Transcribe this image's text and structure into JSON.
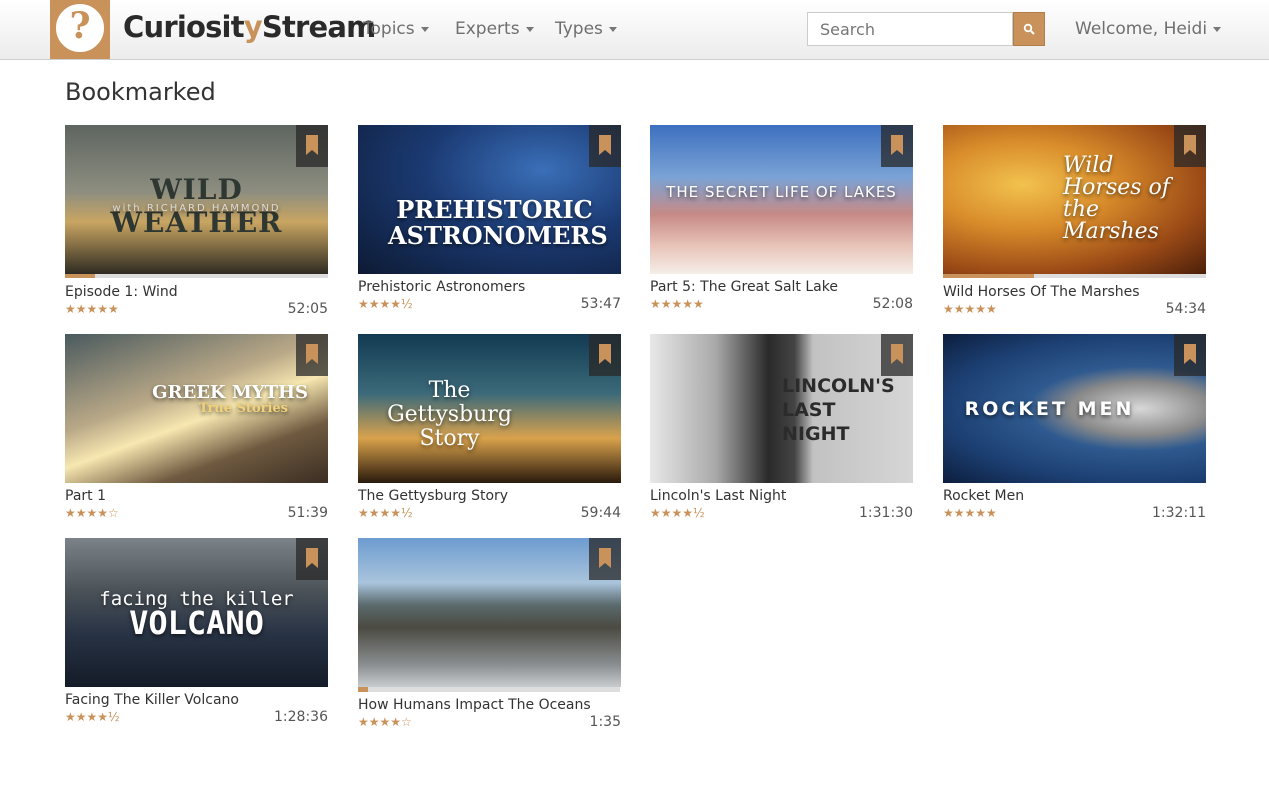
{
  "brand": {
    "name_part1": "Curiosit",
    "name_y": "y",
    "name_part2": "Stream",
    "icon_glyph": "?"
  },
  "nav": {
    "topics": "Topics",
    "experts": "Experts",
    "types": "Types"
  },
  "search": {
    "placeholder": "Search"
  },
  "user": {
    "welcome": "Welcome, Heidi"
  },
  "page": {
    "title": "Bookmarked"
  },
  "colors": {
    "accent": "#c8925a"
  },
  "videos": [
    {
      "name": "Episode 1: Wind",
      "stars": "★★★★★",
      "duration": "52:05",
      "thumb_title": "WILD WEATHER",
      "thumb_sub": "with RICHARD HAMMOND",
      "progress": 0.12
    },
    {
      "name": "Prehistoric Astronomers",
      "stars": "★★★★½",
      "duration": "53:47",
      "thumb_title": "PREHISTORIC ASTRONOMERS",
      "thumb_sub": ""
    },
    {
      "name": "Part 5: The Great Salt Lake",
      "stars": "★★★★★",
      "duration": "52:08",
      "thumb_title": "THE SECRET LIFE OF LAKES",
      "thumb_sub": ""
    },
    {
      "name": "Wild Horses Of The Marshes",
      "stars": "★★★★★",
      "duration": "54:34",
      "thumb_title": "Wild Horses of the Marshes",
      "thumb_sub": "",
      "progress": 0.35
    },
    {
      "name": "Part 1",
      "stars": "★★★★☆",
      "duration": "51:39",
      "thumb_title": "GREEK MYTHS",
      "thumb_sub": "True Stories"
    },
    {
      "name": "The Gettysburg Story",
      "stars": "★★★★½",
      "duration": "59:44",
      "thumb_title": "The Gettysburg Story",
      "thumb_sub": ""
    },
    {
      "name": "Lincoln's Last Night",
      "stars": "★★★★½",
      "duration": "1:31:30",
      "thumb_title": "LINCOLN'S LAST NIGHT",
      "thumb_sub": ""
    },
    {
      "name": "Rocket Men",
      "stars": "★★★★★",
      "duration": "1:32:11",
      "thumb_title": "ROCKET MEN",
      "thumb_sub": ""
    },
    {
      "name": "Facing The Killer Volcano",
      "stars": "★★★★½",
      "duration": "1:28:36",
      "thumb_title": "facing the killer",
      "thumb_sub": "VOLCANO"
    },
    {
      "name": "How Humans Impact The Oceans",
      "stars": "★★★★☆",
      "duration": "1:35",
      "thumb_title": "",
      "thumb_sub": "",
      "progress": 0.04
    }
  ]
}
